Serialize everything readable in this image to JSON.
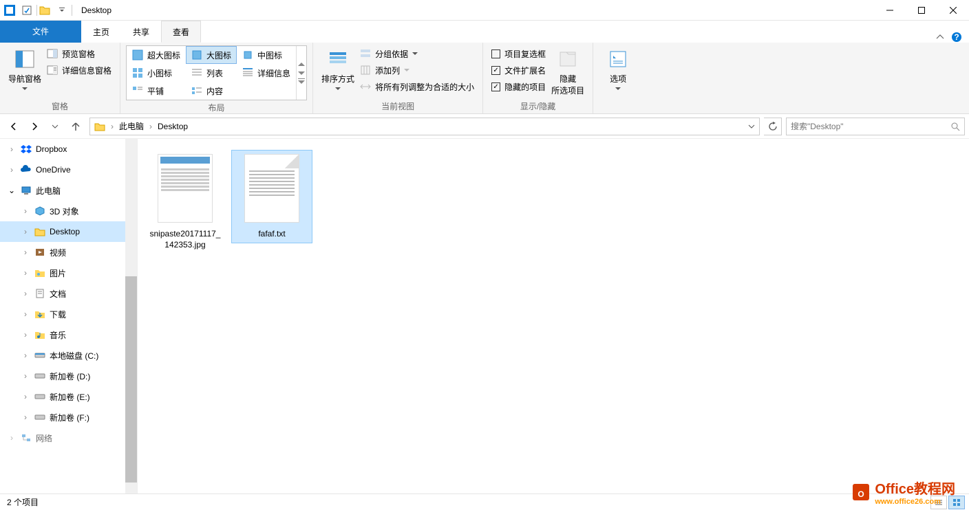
{
  "window": {
    "title": "Desktop"
  },
  "tabs": {
    "file": "文件",
    "home": "主页",
    "share": "共享",
    "view": "查看"
  },
  "ribbon": {
    "pane": {
      "nav": "导航窗格",
      "preview": "预览窗格",
      "details": "详细信息窗格",
      "group": "窗格"
    },
    "layout": {
      "xl": "超大图标",
      "l": "大图标",
      "m": "中图标",
      "s": "小图标",
      "list": "列表",
      "det": "详细信息",
      "tile": "平铺",
      "content": "内容",
      "group": "布局"
    },
    "view": {
      "sort": "排序方式",
      "groupby": "分组依据",
      "addcol": "添加列",
      "fitcols": "将所有列调整为合适的大小",
      "group": "当前视图"
    },
    "showhide": {
      "checkboxes": "项目复选框",
      "ext": "文件扩展名",
      "hidden": "隐藏的项目",
      "hidebtn": "隐藏\n所选项目",
      "group": "显示/隐藏"
    },
    "options": "选项"
  },
  "address": {
    "pc": "此电脑",
    "desktop": "Desktop"
  },
  "search": {
    "placeholder": "搜索\"Desktop\""
  },
  "tree": {
    "dropbox": "Dropbox",
    "onedrive": "OneDrive",
    "pc": "此电脑",
    "3d": "3D 对象",
    "desktop": "Desktop",
    "video": "视频",
    "pictures": "图片",
    "docs": "文档",
    "downloads": "下载",
    "music": "音乐",
    "diskc": "本地磁盘 (C:)",
    "diskd": "新加卷 (D:)",
    "diske": "新加卷 (E:)",
    "diskf": "新加卷 (F:)",
    "net": "网络"
  },
  "files": [
    {
      "name": "snipaste20171117_142353.jpg"
    },
    {
      "name": "fafaf.txt"
    }
  ],
  "status": {
    "count": "2 个项目"
  },
  "watermark": {
    "line1": "Office教程网",
    "line2": "www.office26.com"
  }
}
